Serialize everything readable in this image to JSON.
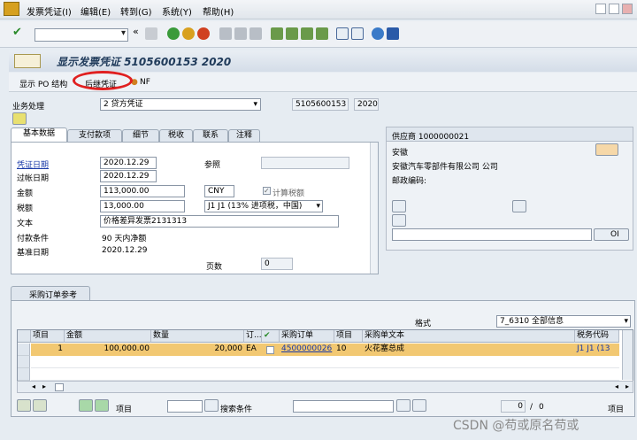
{
  "menu": {
    "items": [
      "发票凭证(I)",
      "编辑(E)",
      "转到(G)",
      "系统(Y)",
      "帮助(H)"
    ]
  },
  "toolbar": {
    "command_field": "",
    "icons": [
      "enter-icon",
      "save-icon",
      "back-icon",
      "exit-icon",
      "cancel-icon",
      "print-icon",
      "find-icon",
      "find-next-icon",
      "first-page-icon",
      "previous-page-icon",
      "next-page-icon",
      "last-page-icon",
      "new-session-icon",
      "shortcut-icon",
      "help-icon",
      "customize-layout-icon"
    ]
  },
  "title": "显示发票凭证 5105600153 2020",
  "app_toolbar": {
    "show_po_structure": "显示 PO 结构",
    "follow_on_documents": "后继凭证",
    "nf": "NF"
  },
  "header": {
    "transaction_label": "业务处理",
    "transaction_value": "2 贷方凭证",
    "doc_number": "5105600153",
    "fiscal_year": "2020"
  },
  "tabs": [
    "基本数据",
    "支付款项",
    "细节",
    "税收",
    "联系",
    "注释"
  ],
  "basic_data": {
    "invoice_date_label": "凭证日期",
    "invoice_date": "2020.12.29",
    "posting_date_label": "过帐日期",
    "posting_date": "2020.12.29",
    "amount_label": "金额",
    "amount": "113,000.00",
    "currency": "CNY",
    "calc_tax_label": "计算税额",
    "tax_label": "税额",
    "tax_amount": "13,000.00",
    "tax_code": "J1 J1 (13% 进项税，中国)",
    "text_label": "文本",
    "text_value": "价格差异发票2131313",
    "payment_terms_label": "付款条件",
    "payment_terms": "90 天内净额",
    "baseline_date_label": "基准日期",
    "baseline_date": "2020.12.29",
    "reference_label": "参照",
    "reference_value": "",
    "pages_label": "页数",
    "pages_value": "0"
  },
  "vendor": {
    "header": "供应商 1000000021",
    "line1": "安徽",
    "line2": "安徽汽车零部件有限公司 公司",
    "postal_label": "邮政编码:",
    "oi_button": "OI"
  },
  "po_reference": {
    "tab_label": "采购订单参考",
    "layout_label": "格式",
    "layout_value": "7_6310 全部信息",
    "columns": [
      "项目",
      "金额",
      "数量",
      "订...",
      "",
      "采购订单",
      "项目",
      "采购单文本",
      "税务代码"
    ],
    "rows": [
      {
        "item": "1",
        "amount": "100,000.00",
        "quantity": "20,000",
        "unit": "EA",
        "po": "4500000026",
        "po_item": "10",
        "text": "火花塞总成",
        "tax_code": "J1  J1 (13"
      }
    ]
  },
  "bottom": {
    "item_label": "项目",
    "item_value": "",
    "search_label": "搜索条件",
    "search_value": "",
    "page_current": "0",
    "page_sep": "/",
    "page_total": "0",
    "item_right_label": "项目"
  },
  "watermark": "CSDN @苟或原名苟或"
}
